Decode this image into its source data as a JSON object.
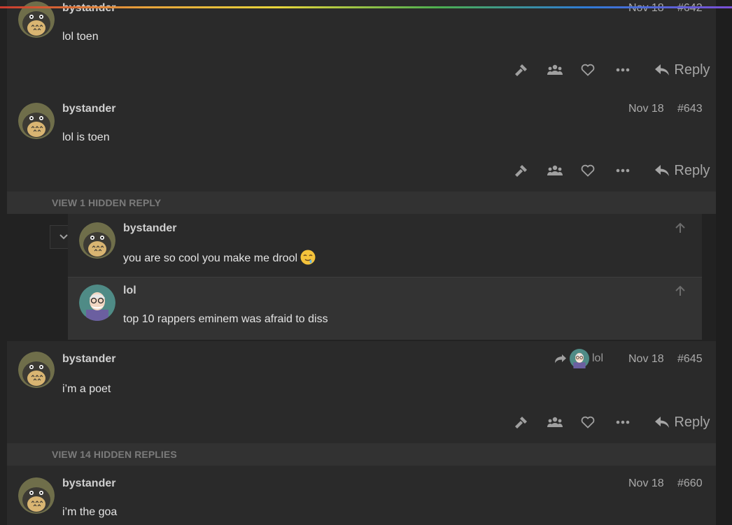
{
  "posts": [
    {
      "username": "bystander",
      "date": "Nov 18",
      "number": "#642",
      "body": "lol toen"
    },
    {
      "username": "bystander",
      "date": "Nov 18",
      "number": "#643",
      "body": "lol is toen"
    },
    {
      "username": "bystander",
      "date": "Nov 18",
      "number": "#645",
      "body": "i’m a poet",
      "reply_to": "lol"
    },
    {
      "username": "bystander",
      "date": "Nov 18",
      "number": "#660",
      "body": "i’m the goa"
    }
  ],
  "actions": {
    "reply_label": "Reply",
    "icons": [
      "flag-hammer-icon",
      "users-icon",
      "heart-icon",
      "more-dots-icon",
      "reply-arrow-icon"
    ]
  },
  "hidden_bars": [
    "VIEW 1 HIDDEN REPLY",
    "VIEW 14 HIDDEN REPLIES"
  ],
  "embedded": [
    {
      "username": "bystander",
      "body": "you are so cool you make me drool",
      "emoji": "drooling-face"
    },
    {
      "username": "lol",
      "body": "top 10 rappers eminem was afraid to diss"
    }
  ],
  "colors": {
    "background": "#222222",
    "post_bg": "#2a2a2a",
    "hidden_bar_bg": "#323232",
    "muted": "#7b7b7b"
  }
}
